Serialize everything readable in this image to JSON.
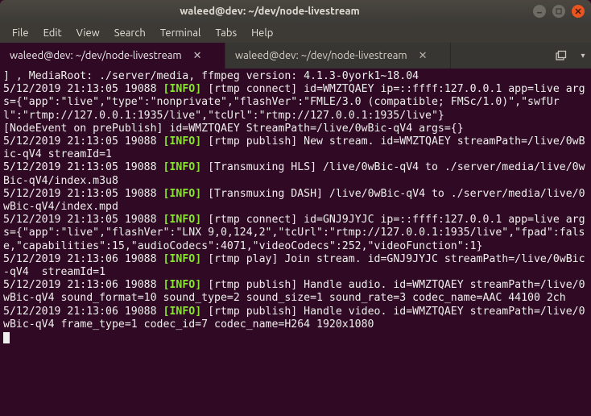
{
  "window": {
    "title": "waleed@dev: ~/dev/node-livestream"
  },
  "menubar": {
    "items": [
      "File",
      "Edit",
      "View",
      "Search",
      "Terminal",
      "Tabs",
      "Help"
    ]
  },
  "tabs": {
    "items": [
      {
        "label": "waleed@dev: ~/dev/node-livestream",
        "active": true
      },
      {
        "label": "waleed@dev: ~/dev/node-livestream",
        "active": false
      }
    ]
  },
  "colors": {
    "bg": "#300a24",
    "fg": "#eeeeec",
    "info": "#8ae234",
    "accent": "#e95420"
  },
  "log": [
    {
      "segments": [
        {
          "t": "] , MediaRoot: ./server/media, ffmpeg version: 4.1.3-0york1~18.04"
        }
      ]
    },
    {
      "segments": [
        {
          "t": "5/12/2019 21:13:05 19088 "
        },
        {
          "t": "[INFO]",
          "c": "info"
        },
        {
          "t": " [rtmp connect] id=WMZTQAEY ip=::ffff:127.0.0.1 app=live args={\"app\":\"live\",\"type\":\"nonprivate\",\"flashVer\":\"FMLE/3.0 (compatible; FMSc/1.0)\",\"swfUrl\":\"rtmp://127.0.0.1:1935/live\",\"tcUrl\":\"rtmp://127.0.0.1:1935/live\"}"
        }
      ]
    },
    {
      "segments": [
        {
          "t": "[NodeEvent on prePublish] id=WMZTQAEY StreamPath=/live/0wBic-qV4 args={}"
        }
      ]
    },
    {
      "segments": [
        {
          "t": "5/12/2019 21:13:05 19088 "
        },
        {
          "t": "[INFO]",
          "c": "info"
        },
        {
          "t": " [rtmp publish] New stream. id=WMZTQAEY streamPath=/live/0wBic-qV4 streamId=1"
        }
      ]
    },
    {
      "segments": [
        {
          "t": "5/12/2019 21:13:05 19088 "
        },
        {
          "t": "[INFO]",
          "c": "info"
        },
        {
          "t": " [Transmuxing HLS] /live/0wBic-qV4 to ./server/media/live/0wBic-qV4/index.m3u8"
        }
      ]
    },
    {
      "segments": [
        {
          "t": "5/12/2019 21:13:05 19088 "
        },
        {
          "t": "[INFO]",
          "c": "info"
        },
        {
          "t": " [Transmuxing DASH] /live/0wBic-qV4 to ./server/media/live/0wBic-qV4/index.mpd"
        }
      ]
    },
    {
      "segments": [
        {
          "t": "5/12/2019 21:13:05 19088 "
        },
        {
          "t": "[INFO]",
          "c": "info"
        },
        {
          "t": " [rtmp connect] id=GNJ9JYJC ip=::ffff:127.0.0.1 app=live args={\"app\":\"live\",\"flashVer\":\"LNX 9,0,124,2\",\"tcUrl\":\"rtmp://127.0.0.1:1935/live\",\"fpad\":false,\"capabilities\":15,\"audioCodecs\":4071,\"videoCodecs\":252,\"videoFunction\":1}"
        }
      ]
    },
    {
      "segments": [
        {
          "t": "5/12/2019 21:13:06 19088 "
        },
        {
          "t": "[INFO]",
          "c": "info"
        },
        {
          "t": " [rtmp play] Join stream. id=GNJ9JYJC streamPath=/live/0wBic-qV4  streamId=1"
        }
      ]
    },
    {
      "segments": [
        {
          "t": "5/12/2019 21:13:06 19088 "
        },
        {
          "t": "[INFO]",
          "c": "info"
        },
        {
          "t": " [rtmp publish] Handle audio. id=WMZTQAEY streamPath=/live/0wBic-qV4 sound_format=10 sound_type=2 sound_size=1 sound_rate=3 codec_name=AAC 44100 2ch"
        }
      ]
    },
    {
      "segments": [
        {
          "t": "5/12/2019 21:13:06 19088 "
        },
        {
          "t": "[INFO]",
          "c": "info"
        },
        {
          "t": " [rtmp publish] Handle video. id=WMZTQAEY streamPath=/live/0wBic-qV4 frame_type=1 codec_id=7 codec_name=H264 1920x1080"
        }
      ]
    }
  ]
}
